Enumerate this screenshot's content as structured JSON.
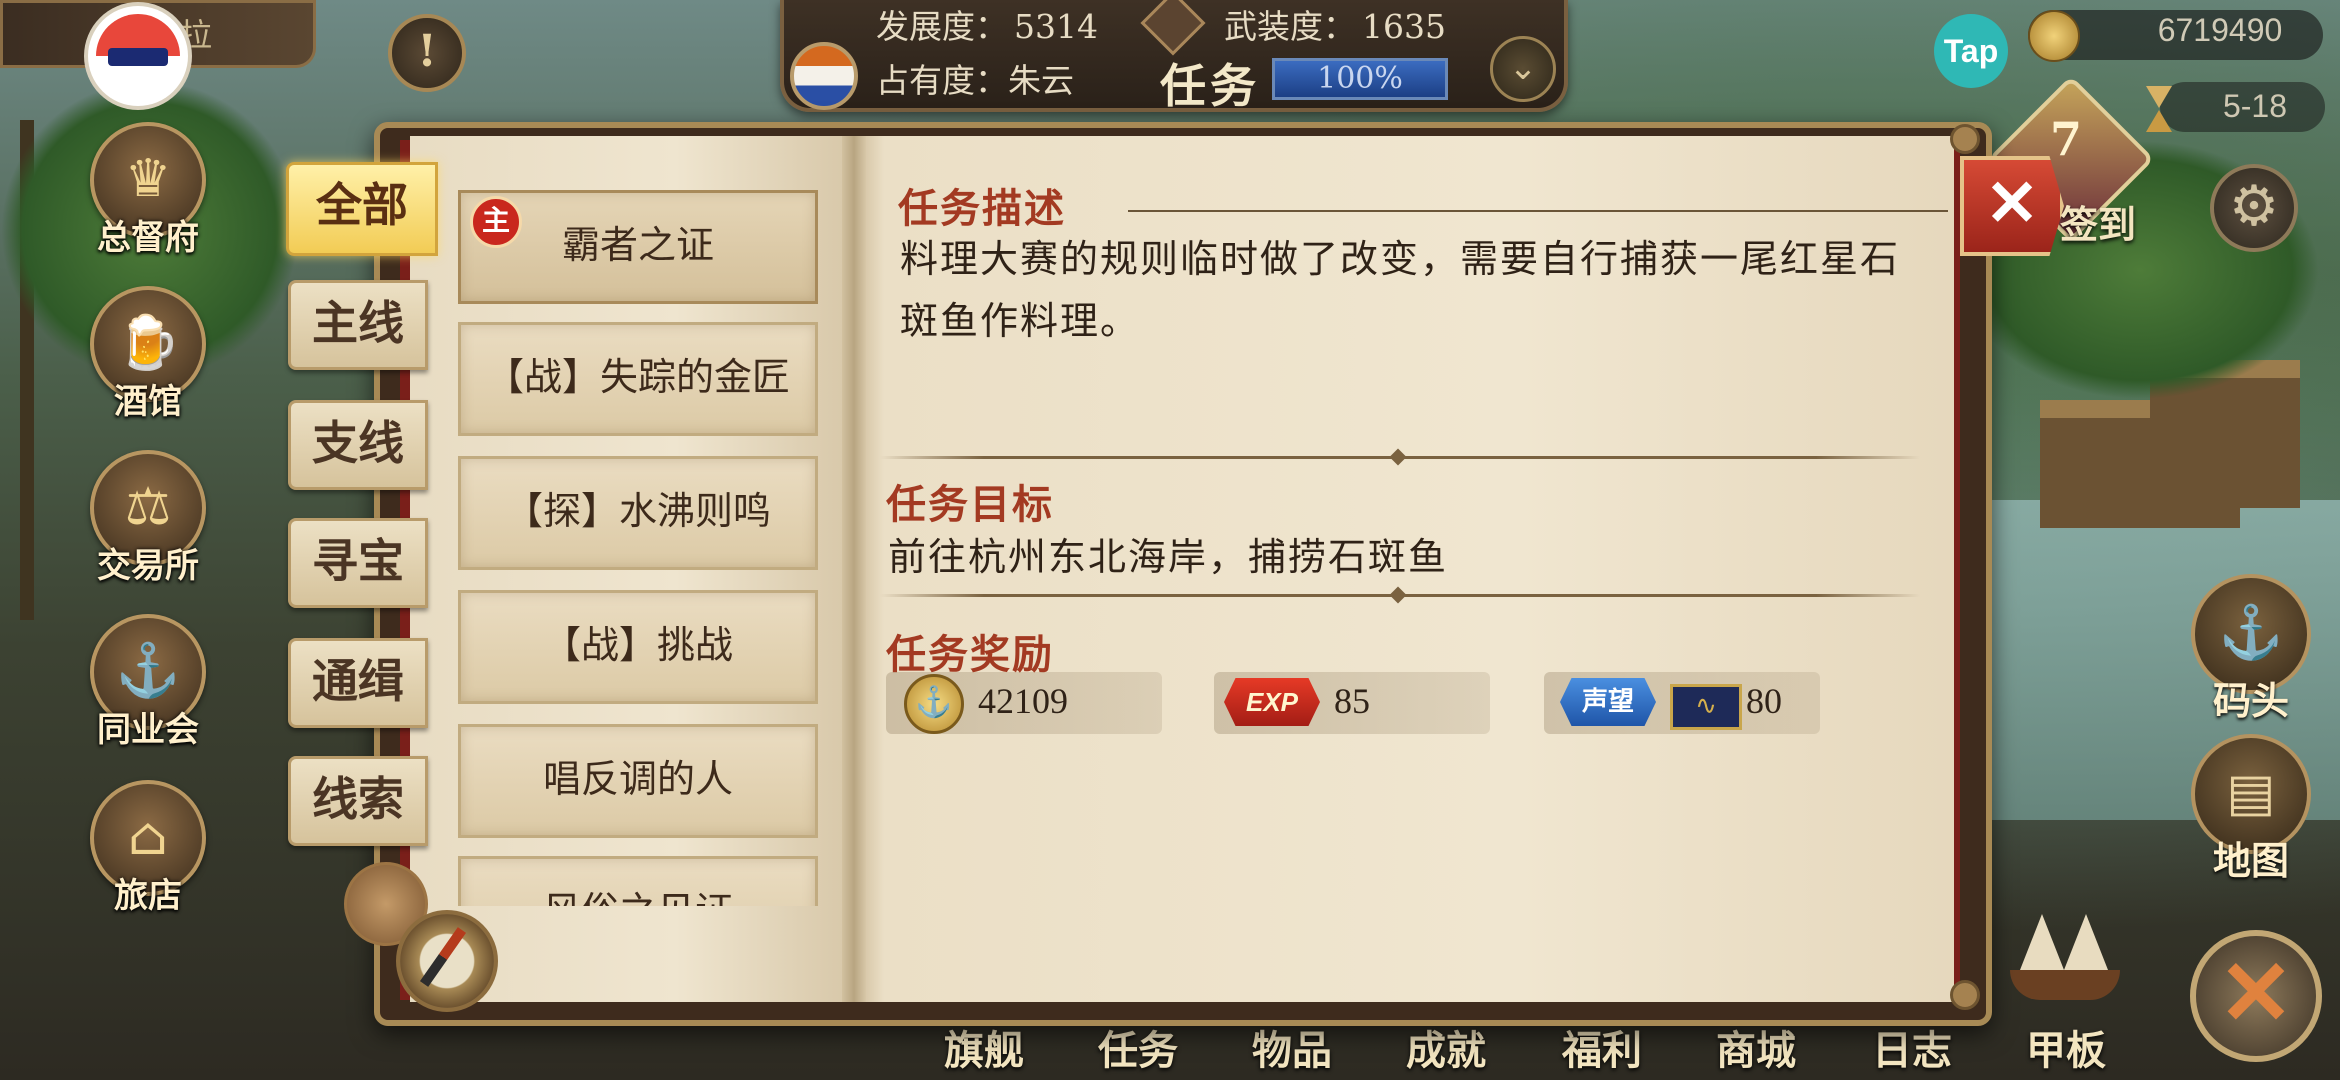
{
  "hud": {
    "development_label": "发展度：",
    "development_value": "5314",
    "armament_label": "武装度：",
    "armament_value": "1635",
    "occupancy_label": "占有度：",
    "occupancy_value": "朱云",
    "task_title": "任务",
    "progress_label": "100%",
    "progress_fraction": 1.0
  },
  "profile": {
    "name_fragment": "拉"
  },
  "currency": {
    "coins": "6719490",
    "date": "5-18",
    "tap_label": "Tap"
  },
  "signin": {
    "badge_number": "7",
    "label": "签到"
  },
  "left_nav": [
    {
      "label": "总督府",
      "icon": "crown-icon"
    },
    {
      "label": "酒馆",
      "icon": "beer-mug-icon"
    },
    {
      "label": "交易所",
      "icon": "scales-icon"
    },
    {
      "label": "同业会",
      "icon": "anchor-shield-icon"
    },
    {
      "label": "旅店",
      "icon": "bed-icon"
    }
  ],
  "right_nav": [
    {
      "label": "码头",
      "icon": "dock-icon"
    },
    {
      "label": "地图",
      "icon": "map-scroll-icon"
    }
  ],
  "bottom_nav": [
    "旗舰",
    "任务",
    "物品",
    "成就",
    "福利",
    "商城",
    "日志",
    "甲板"
  ],
  "categories": [
    "全部",
    "主线",
    "支线",
    "寻宝",
    "通缉",
    "线索"
  ],
  "active_category": "全部",
  "quests": [
    {
      "title": "霸者之证",
      "badge": "主"
    },
    {
      "title": "【战】失踪的金匠"
    },
    {
      "title": "【探】水沸则鸣"
    },
    {
      "title": "【战】挑战"
    },
    {
      "title": "唱反调的人"
    },
    {
      "title": "风俗之见证"
    }
  ],
  "detail": {
    "description_header": "任务描述",
    "description": "料理大赛的规则临时做了改变，需要自行捕获一尾红星石斑鱼作料理。",
    "target_header": "任务目标",
    "target": "前往杭州东北海岸，捕捞石斑鱼",
    "reward_header": "任务奖励",
    "rewards": {
      "gold": "42109",
      "exp_label": "EXP",
      "exp": "85",
      "reputation_label": "声望",
      "reputation": "80"
    }
  },
  "close_label": "✕"
}
